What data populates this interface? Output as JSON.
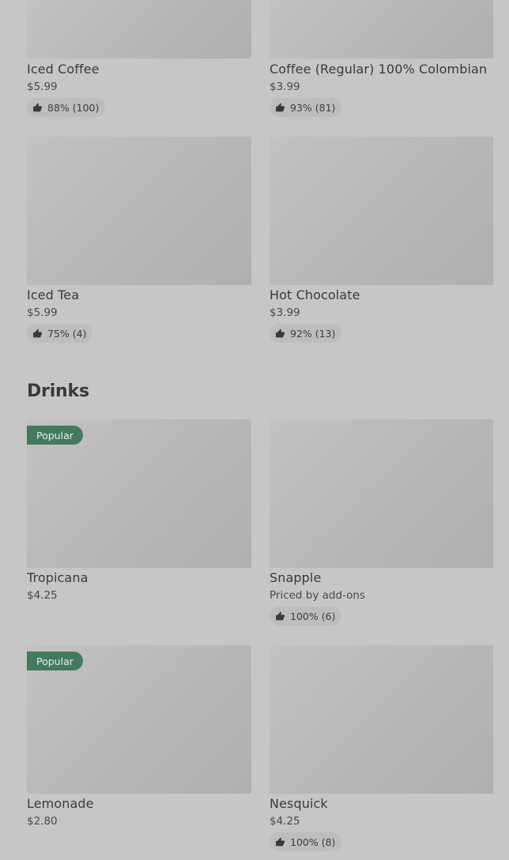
{
  "top_items": [
    {
      "name": "Iced Coffee",
      "price": "$5.99",
      "rating": "88% (100)"
    },
    {
      "name": "Coffee (Regular) 100% Colombian",
      "price": "$3.99",
      "rating": "93% (81)"
    },
    {
      "name": "Iced Tea",
      "price": "$5.99",
      "rating": "75% (4)"
    },
    {
      "name": "Hot Chocolate",
      "price": "$3.99",
      "rating": "92% (13)"
    }
  ],
  "drinks": {
    "title": "Drinks",
    "items": [
      {
        "name": "Tropicana",
        "price": "$4.25",
        "badge": "Popular"
      },
      {
        "name": "Snapple",
        "price": "Priced by add-ons",
        "rating": "100% (6)"
      },
      {
        "name": "Lemonade",
        "price": "$2.80",
        "badge": "Popular"
      },
      {
        "name": "Nesquick",
        "price": "$4.25",
        "rating": "100% (8)"
      }
    ]
  },
  "icons": {
    "rating": "thumbs-up-icon"
  }
}
